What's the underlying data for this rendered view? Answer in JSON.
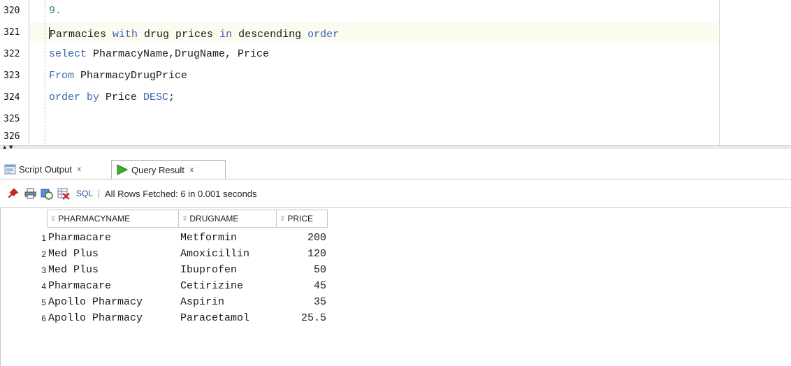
{
  "editor": {
    "line_numbers": [
      "320",
      "321",
      "322",
      "323",
      "324",
      "325",
      "326"
    ],
    "lines": [
      {
        "parts": [
          {
            "t": "9.",
            "k": "num"
          }
        ]
      },
      {
        "parts": [
          {
            "t": "Parmacies ",
            "k": ""
          },
          {
            "t": "with",
            "k": "kw"
          },
          {
            "t": " drug prices ",
            "k": ""
          },
          {
            "t": "in",
            "k": "kw"
          },
          {
            "t": " descending ",
            "k": ""
          },
          {
            "t": "order",
            "k": "kw"
          }
        ]
      },
      {
        "parts": [
          {
            "t": "select",
            "k": "kw"
          },
          {
            "t": " PharmacyName,DrugName, Price",
            "k": ""
          }
        ]
      },
      {
        "parts": [
          {
            "t": "From",
            "k": "kw"
          },
          {
            "t": " PharmacyDrugPrice",
            "k": ""
          }
        ]
      },
      {
        "parts": [
          {
            "t": "order by",
            "k": "kw"
          },
          {
            "t": " Price ",
            "k": ""
          },
          {
            "t": "DESC",
            "k": "kw"
          },
          {
            "t": ";",
            "k": ""
          }
        ]
      },
      {
        "parts": []
      },
      {
        "parts": []
      }
    ],
    "colors": {
      "keyword": "#3a66b0",
      "number": "#2e8b57",
      "current_line": "#fbfbf0"
    }
  },
  "tabs": {
    "script_output": {
      "label": "Script Output",
      "close": "x",
      "icon": "script-output-icon"
    },
    "query_result": {
      "label": "Query Result",
      "close": "x",
      "icon": "run-triangle-icon"
    }
  },
  "toolbar": {
    "sql_label": "SQL",
    "status": "All Rows Fetched: 6 in 0.001 seconds",
    "icons": [
      "pin-icon",
      "print-icon",
      "refresh-icon",
      "export-icon"
    ]
  },
  "grid": {
    "columns": [
      "PHARMACYNAME",
      "DRUGNAME",
      "PRICE"
    ],
    "rows": [
      {
        "n": "1",
        "pharmacy": "Pharmacare",
        "drug": "Metformin",
        "price": "200"
      },
      {
        "n": "2",
        "pharmacy": "Med Plus",
        "drug": "Amoxicillin",
        "price": "120"
      },
      {
        "n": "3",
        "pharmacy": "Med Plus",
        "drug": "Ibuprofen",
        "price": "50"
      },
      {
        "n": "4",
        "pharmacy": "Pharmacare",
        "drug": "Cetirizine",
        "price": "45"
      },
      {
        "n": "5",
        "pharmacy": "Apollo Pharmacy",
        "drug": "Aspirin",
        "price": "35"
      },
      {
        "n": "6",
        "pharmacy": "Apollo Pharmacy",
        "drug": "Paracetamol",
        "price": "25.5"
      }
    ]
  }
}
